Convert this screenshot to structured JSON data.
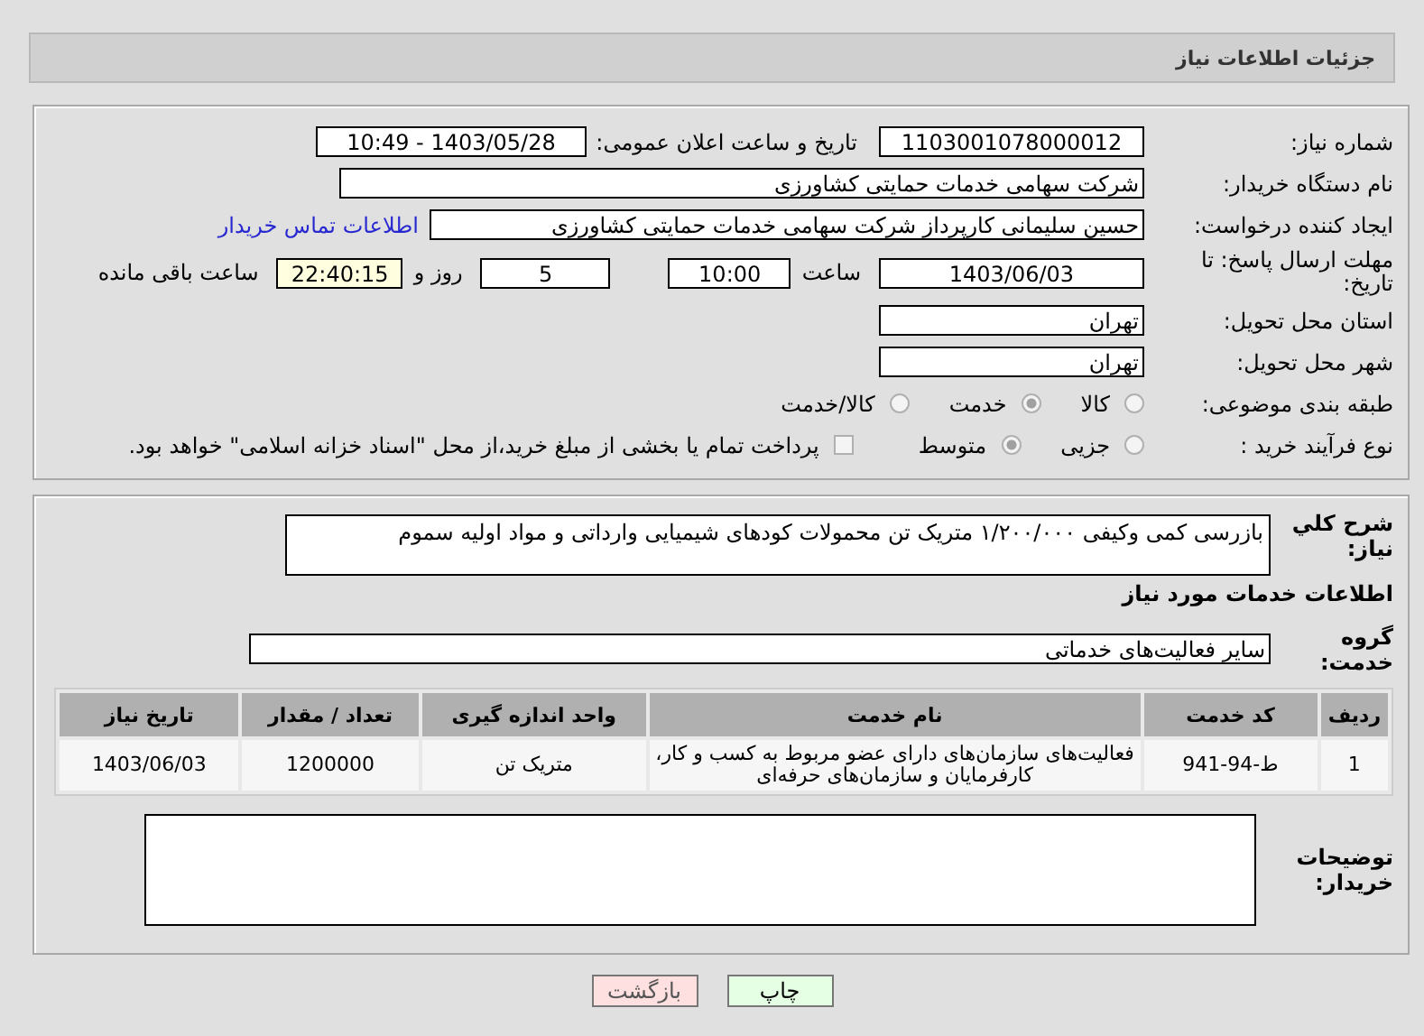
{
  "header": {
    "title": "جزئیات اطلاعات نیاز"
  },
  "need_number": {
    "label": "شماره نیاز:",
    "value": "1103001078000012"
  },
  "announce": {
    "label": "تاریخ و ساعت اعلان عمومی:",
    "value": "1403/05/28 - 10:49"
  },
  "buyer": {
    "label": "نام دستگاه خریدار:",
    "value": "شرکت سهامی خدمات حمایتی کشاورزی"
  },
  "requester": {
    "label": "ایجاد کننده درخواست:",
    "value": "حسین سلیمانی کارپرداز شرکت سهامی خدمات حمایتی کشاورزی",
    "link": "اطلاعات تماس خریدار"
  },
  "deadline": {
    "label": "مهلت ارسال پاسخ: تا تاریخ:",
    "date": "1403/06/03",
    "time_label": "ساعت",
    "time": "10:00",
    "days": "5",
    "days_label": "روز و",
    "remaining": "22:40:15",
    "remaining_label": "ساعت باقی مانده"
  },
  "province": {
    "label": "استان محل تحویل:",
    "value": "تهران"
  },
  "city": {
    "label": "شهر محل تحویل:",
    "value": "تهران"
  },
  "category": {
    "label": "طبقه بندی موضوعی:",
    "options": [
      {
        "label": "کالا",
        "selected": false
      },
      {
        "label": "خدمت",
        "selected": true
      },
      {
        "label": "کالا/خدمت",
        "selected": false
      }
    ]
  },
  "process": {
    "label": "نوع فرآیند خرید :",
    "options": [
      {
        "label": "جزیی",
        "selected": false
      },
      {
        "label": "متوسط",
        "selected": true
      }
    ],
    "payment": {
      "label": "پرداخت تمام یا بخشی از مبلغ خرید،از محل \"اسناد خزانه اسلامی\" خواهد بود.",
      "checked": false
    }
  },
  "description": {
    "label": "شرح کلي نياز:",
    "value": "بازرسی کمی وکیفی ۱/۲۰۰/۰۰۰ متریک تن محمولات کودهای شیمیایی وارداتی و مواد اولیه سموم"
  },
  "services_heading": "اطلاعات خدمات مورد نياز",
  "service_group": {
    "label": "گروه خدمت:",
    "value": "سایر فعالیت‌های خدماتی"
  },
  "table": {
    "columns": [
      "ردیف",
      "کد خدمت",
      "نام خدمت",
      "واحد اندازه گیری",
      "تعداد / مقدار",
      "تاریخ نیاز"
    ],
    "rows": [
      [
        "1",
        "ط-94-941",
        "فعالیت‌های سازمان‌های دارای عضو مربوط به کسب و کار، کارفرمایان و سازمان‌های حرفه‌ای",
        "متریک تن",
        "1200000",
        "1403/06/03"
      ]
    ]
  },
  "buyer_notes": {
    "label": "توضیحات خریدار:"
  },
  "buttons": [
    {
      "label": "چاپ",
      "kind": "print"
    },
    {
      "label": "بازگشت",
      "kind": "back"
    }
  ]
}
